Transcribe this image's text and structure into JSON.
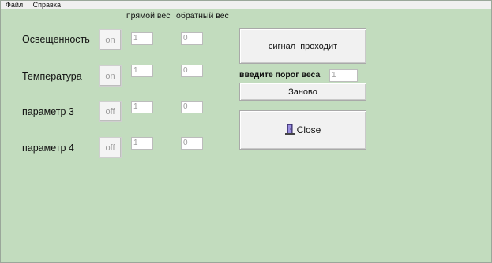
{
  "menu": {
    "file": "Файл",
    "help": "Справка"
  },
  "columns": {
    "forward": "прямой вес",
    "reverse": "обратный вес"
  },
  "params": [
    {
      "label": "Освещенность",
      "toggle": "on",
      "forward": "1",
      "reverse": "0"
    },
    {
      "label": "Температура",
      "toggle": "on",
      "forward": "1",
      "reverse": "0"
    },
    {
      "label": "параметр 3",
      "toggle": "off",
      "forward": "1",
      "reverse": "0"
    },
    {
      "label": "параметр 4",
      "toggle": "off",
      "forward": "1",
      "reverse": "0"
    }
  ],
  "signal_button": "сигнал  проходит",
  "threshold": {
    "label": "введите порог веса",
    "value": "1"
  },
  "reset_button": "Заново",
  "close_button": "Close",
  "icons": {
    "close": "door-exit-icon"
  }
}
